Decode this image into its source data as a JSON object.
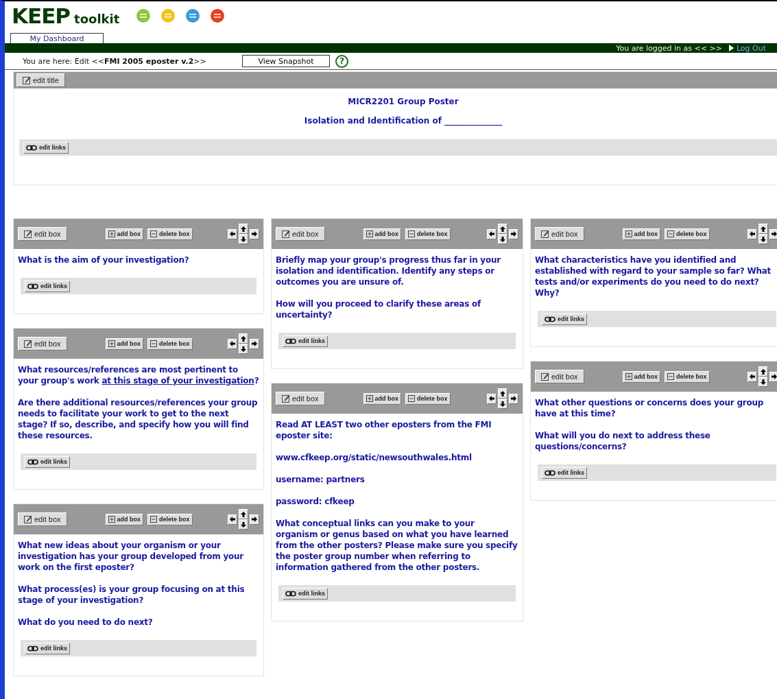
{
  "header": {
    "logo_main": "KEEP",
    "logo_sub": "toolkit"
  },
  "tabs": [
    {
      "label": "My Dashboard",
      "selected": true
    }
  ],
  "user_bar": {
    "text": "You are logged in as << >>",
    "logout": "Log Out"
  },
  "breadcrumb": {
    "text": "You are here: Edit <<**FMI 2005 eposter v.2**>>",
    "snapshot_button": "View Snapshot",
    "help": "?"
  },
  "title_section": {
    "edit_title": "edit title",
    "lines": [
      "MICR2201 Group Poster",
      "Isolation and Identification of ______________"
    ],
    "links_button": "edit links"
  },
  "columns": [
    {
      "boxes": [
        {
          "buttons": [
            "edit box",
            "add box",
            "delete box"
          ],
          "paragraphs": [
            {
              "parts": [
                {
                  "text": "What is the aim of your investigation?",
                  "underlined": false
                }
              ]
            }
          ],
          "links_button": "edit links"
        },
        {
          "buttons": [
            "edit box",
            "add box",
            "delete box"
          ],
          "paragraphs": [
            {
              "parts": [
                {
                  "text": "What resources/references are most pertinent to your group's work ",
                  "underlined": false
                },
                {
                  "text": "at this stage of your investigation",
                  "underlined": true
                },
                {
                  "text": "?",
                  "underlined": false
                }
              ]
            },
            {
              "parts": [
                {
                  "text": "Are there additional resources/references your group needs to facilitate your work to get to the next stage? If so, describe, and specify how you will find these resources.",
                  "underlined": false
                }
              ]
            }
          ],
          "links_button": "edit links"
        },
        {
          "buttons": [
            "edit box",
            "add box",
            "delete box"
          ],
          "paragraphs": [
            {
              "parts": [
                {
                  "text": "What new ideas about your organism or your investigation has your group developed from your work on the first eposter?",
                  "underlined": false
                }
              ]
            },
            {
              "parts": [
                {
                  "text": "What process(es) is your group focusing on at this stage of your investigation?",
                  "underlined": false
                }
              ]
            },
            {
              "parts": [
                {
                  "text": "What do you need to do next?",
                  "underlined": false
                }
              ]
            }
          ],
          "links_button": "edit links"
        }
      ]
    },
    {
      "boxes": [
        {
          "buttons": [
            "edit box",
            "add box",
            "delete box"
          ],
          "paragraphs": [
            {
              "parts": [
                {
                  "text": "Briefly map your group's progress thus far in your isolation and identification. Identify any steps or outcomes you are unsure of.",
                  "underlined": false
                }
              ]
            },
            {
              "parts": [
                {
                  "text": "How will you proceed to clarify these areas of uncertainty?",
                  "underlined": false
                }
              ]
            }
          ],
          "links_button": "edit links"
        },
        {
          "buttons": [
            "edit box",
            "add box",
            "delete box"
          ],
          "paragraphs": [
            {
              "parts": [
                {
                  "text": "Read AT LEAST two other eposters from the FMI eposter site:",
                  "underlined": false
                }
              ]
            },
            {
              "parts": [
                {
                  "text": "www.cfkeep.org/static/newsouthwales.html",
                  "underlined": false
                }
              ]
            },
            {
              "parts": [
                {
                  "text": "username: partners",
                  "underlined": false
                }
              ]
            },
            {
              "parts": [
                {
                  "text": "password: cfkeep",
                  "underlined": false
                }
              ]
            },
            {
              "parts": [
                {
                  "text": "What conceptual links can you make to your organism or genus based on what you have learned from the other posters? Please make sure you specify the poster group number when referring to information gathered from the other posters.",
                  "underlined": false
                }
              ]
            }
          ],
          "links_button": "edit links"
        }
      ]
    },
    {
      "boxes": [
        {
          "buttons": [
            "edit box",
            "add box",
            "delete box"
          ],
          "paragraphs": [
            {
              "parts": [
                {
                  "text": "What characteristics have you identified and established with regard to your sample so far? What tests and/or experiments do you need to do next? Why?",
                  "underlined": false
                }
              ]
            }
          ],
          "links_button": "edit links"
        },
        {
          "buttons": [
            "edit box",
            "add box",
            "delete box"
          ],
          "paragraphs": [
            {
              "parts": [
                {
                  "text": "What other questions or concerns does your group have at this time?",
                  "underlined": false
                }
              ]
            },
            {
              "parts": [
                {
                  "text": "What will you do next to address these questions/concerns?",
                  "underlined": false
                }
              ]
            }
          ],
          "links_button": "edit links"
        }
      ]
    }
  ]
}
